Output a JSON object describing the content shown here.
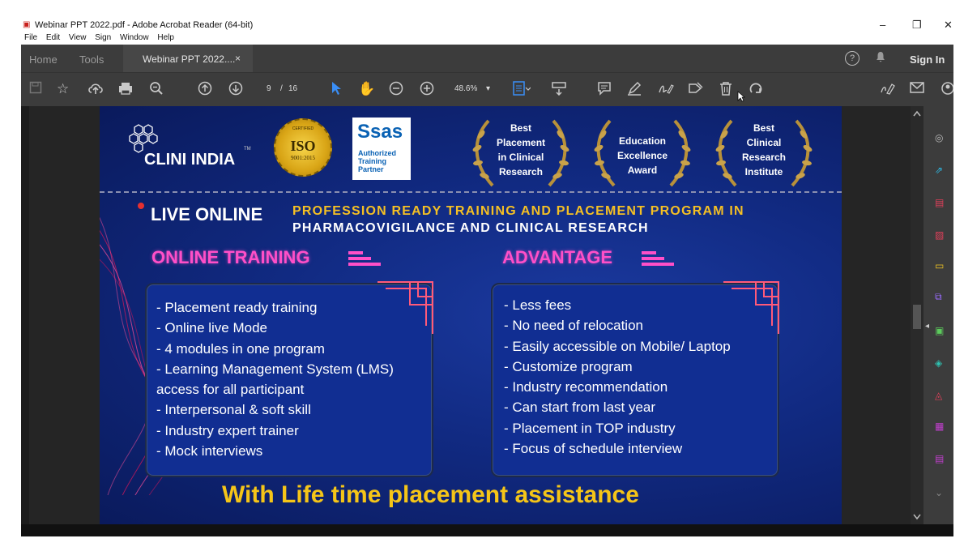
{
  "window": {
    "title": "Webinar PPT 2022.pdf - Adobe Acrobat Reader (64-bit)",
    "controls": {
      "minimize": "–",
      "restore": "❐",
      "close": "✕"
    }
  },
  "menu": [
    "File",
    "Edit",
    "View",
    "Sign",
    "Window",
    "Help"
  ],
  "tabs": {
    "home": "Home",
    "tools": "Tools",
    "document": "Webinar PPT 2022....",
    "close": "×",
    "help": "?",
    "signin": "Sign In"
  },
  "toolbar": {
    "page_current": "9",
    "page_separator": "/",
    "page_total": "16",
    "zoom": "48.6%",
    "zoom_arrow": "▾"
  },
  "slide": {
    "brand": {
      "name": "CLINI INDIA",
      "tm": "TM"
    },
    "iso": {
      "top": "CERTIFIED",
      "main": "ISO",
      "sub": "9001:2015"
    },
    "sas": {
      "logo": "Ssas",
      "line1": "Authorized",
      "line2": "Training",
      "line3": "Partner"
    },
    "awards": [
      {
        "lines": [
          "Best",
          "Placement",
          "in Clinical",
          "Research"
        ]
      },
      {
        "lines": [
          "Education",
          "Excellence",
          "Award"
        ]
      },
      {
        "lines": [
          "Best",
          "Clinical",
          "Research",
          "Institute"
        ]
      }
    ],
    "live": "LIVE ONLINE",
    "program_line1": "PROFESSION READY TRAINING AND PLACEMENT PROGRAM IN",
    "program_line2": "PHARMACOVIGILANCE AND CLINICAL RESEARCH",
    "training": {
      "heading": "ONLINE TRAINING",
      "items": [
        "- Placement ready training",
        "- Online live Mode",
        "- 4 modules in one program",
        "- Learning Management System (LMS)",
        "access for all participant",
        "- Interpersonal & soft skill",
        "- Industry expert trainer",
        "- Mock interviews"
      ]
    },
    "advantage": {
      "heading": "ADVANTAGE",
      "items": [
        "- Less fees",
        "- No need of relocation",
        "- Easily accessible on Mobile/ Laptop",
        "- Customize program",
        "-  Industry recommendation",
        "- Can start from last year",
        "- Placement in TOP industry",
        "- Focus of schedule interview"
      ]
    },
    "tagline": "With Life time placement assistance"
  },
  "colors": {
    "app_bg": "#3c3c3c",
    "slide_bg": "#112a82",
    "gold": "#f5c518",
    "pink": "#ff4fc8"
  }
}
